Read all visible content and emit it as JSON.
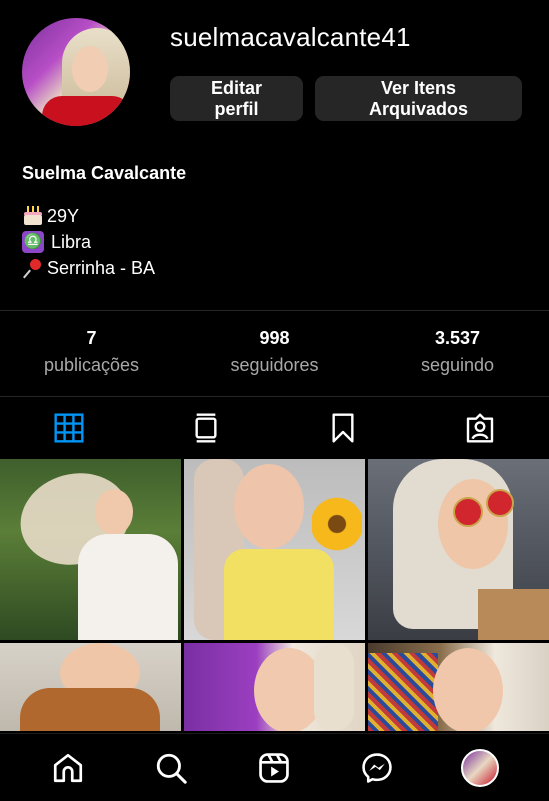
{
  "profile": {
    "username": "suelmacavalcante41",
    "full_name": "Suelma Cavalcante",
    "edit_button": "Editar perfil",
    "archive_button": "Ver Itens Arquivados",
    "bio": [
      {
        "icon": "birthday-cake-icon",
        "text": "29Y"
      },
      {
        "icon": "libra-icon",
        "text": "Libra"
      },
      {
        "icon": "pushpin-icon",
        "text": "Serrinha - BA"
      }
    ]
  },
  "stats": {
    "posts": {
      "value": "7",
      "label": "publicações"
    },
    "followers": {
      "value": "998",
      "label": "seguidores"
    },
    "following": {
      "value": "3.537",
      "label": "seguindo"
    }
  },
  "tabs": [
    {
      "name": "posts-grid-icon",
      "active": true
    },
    {
      "name": "reels-feed-icon",
      "active": false
    },
    {
      "name": "saved-bookmark-icon",
      "active": false
    },
    {
      "name": "tagged-icon",
      "active": false
    }
  ],
  "nav": [
    {
      "name": "home-icon"
    },
    {
      "name": "search-icon"
    },
    {
      "name": "reels-icon"
    },
    {
      "name": "messenger-icon"
    },
    {
      "name": "profile-avatar"
    }
  ],
  "colors": {
    "background": "#000000",
    "button_bg": "#262626",
    "secondary_text": "#a8a8a8",
    "active_tab": "#0095f6",
    "icon_color": "#ffffff"
  }
}
